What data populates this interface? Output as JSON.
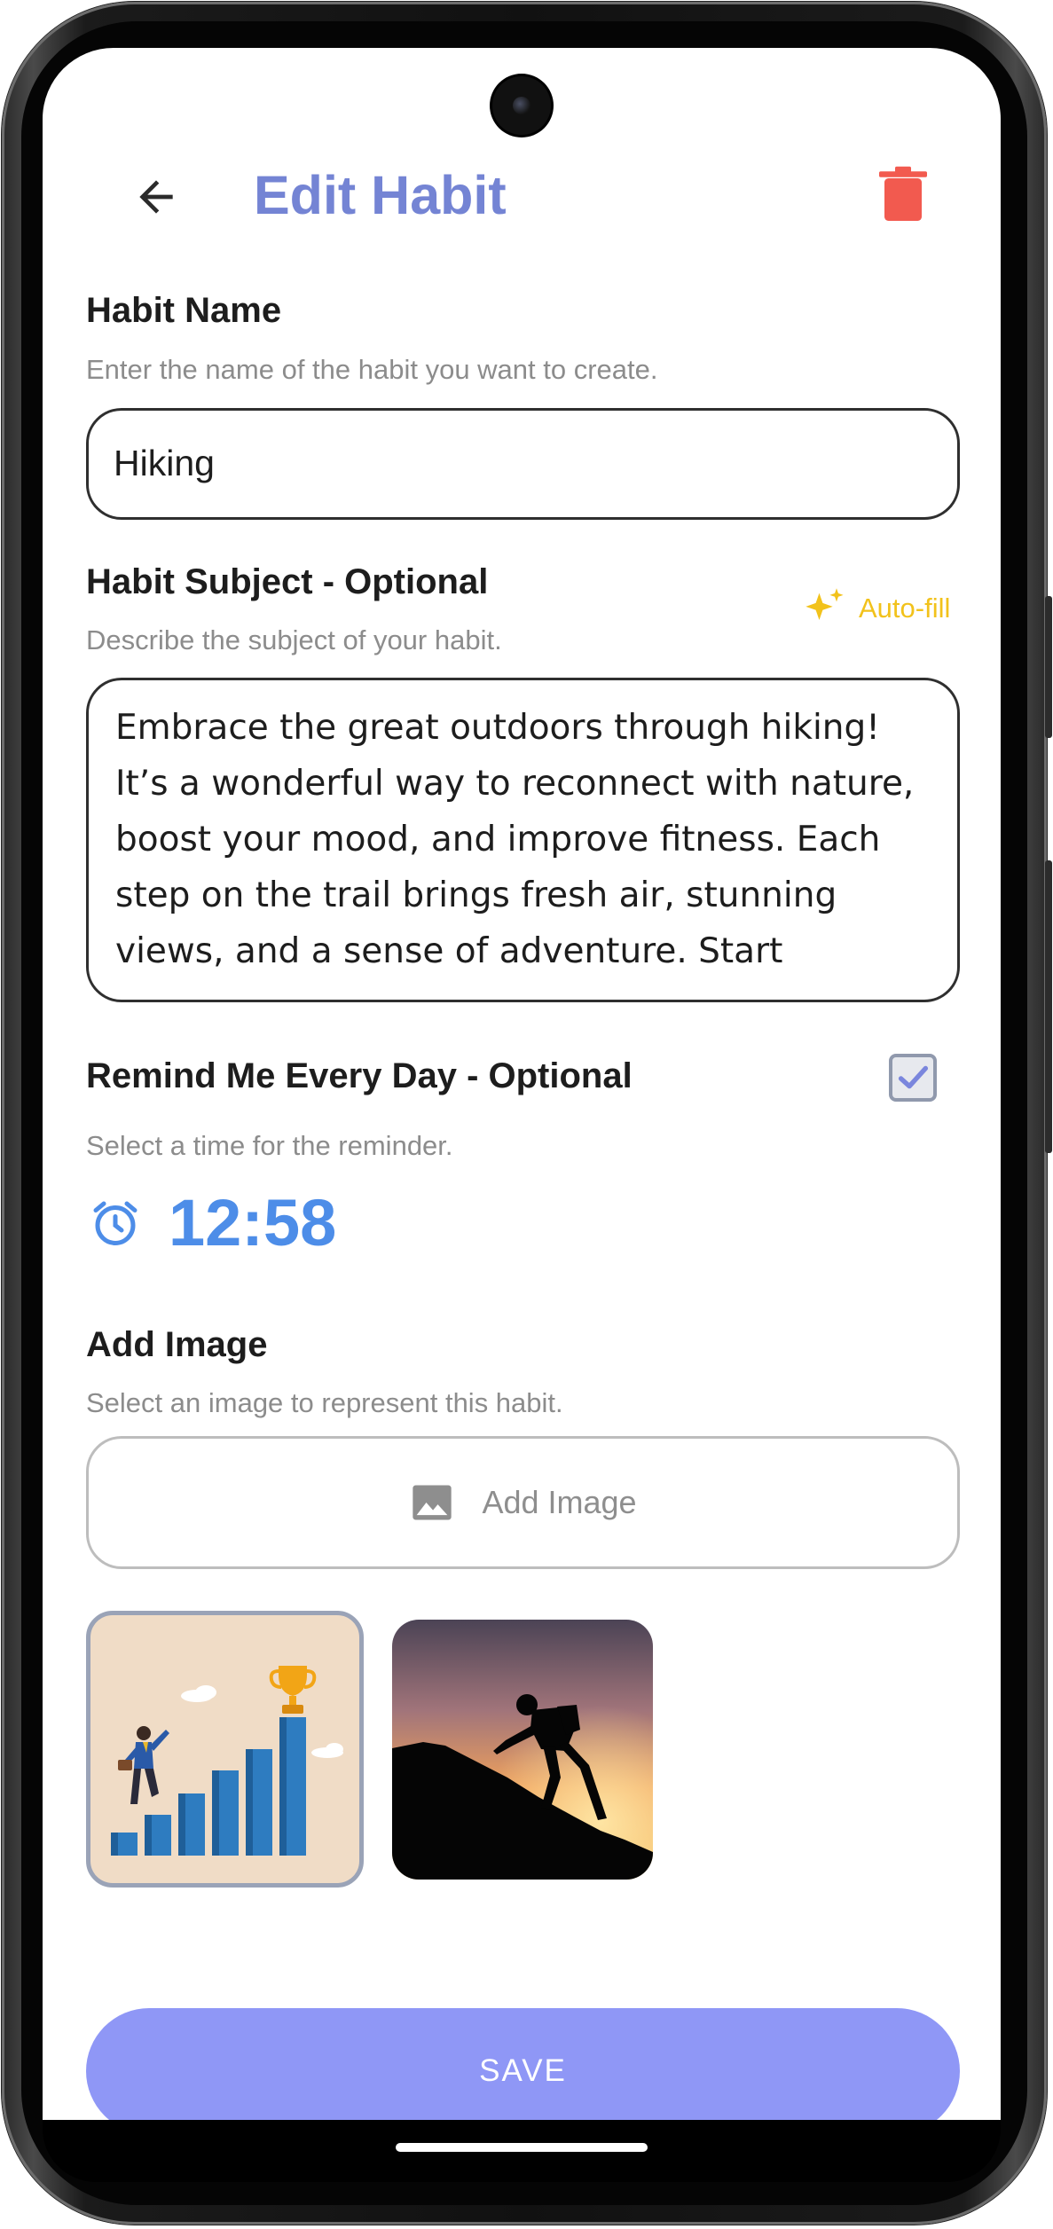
{
  "header": {
    "title": "Edit Habit"
  },
  "habit_name": {
    "label": "Habit Name",
    "hint": "Enter the name of the habit you want to create.",
    "value": "Hiking"
  },
  "habit_subject": {
    "label": "Habit Subject - Optional",
    "hint": "Describe the subject of your habit.",
    "autofill_label": "Auto-fill",
    "value": "Embrace the great outdoors through hiking! It’s a wonderful way to reconnect with nature, boost your mood, and improve fitness. Each step on the trail brings fresh air, stunning views, and a sense of adventure. Start"
  },
  "reminder": {
    "label": "Remind Me Every Day - Optional",
    "hint": "Select a time for the reminder.",
    "checked": true,
    "time": "12:58"
  },
  "image": {
    "label": "Add Image",
    "hint": "Select an image to represent this habit.",
    "button_label": "Add Image"
  },
  "footer": {
    "save_label": "SAVE"
  },
  "colors": {
    "title": "#7484d4",
    "delete": "#f25a4f",
    "autofill": "#f2c21b",
    "time": "#4d8de8",
    "save_button": "#8f97f6"
  }
}
